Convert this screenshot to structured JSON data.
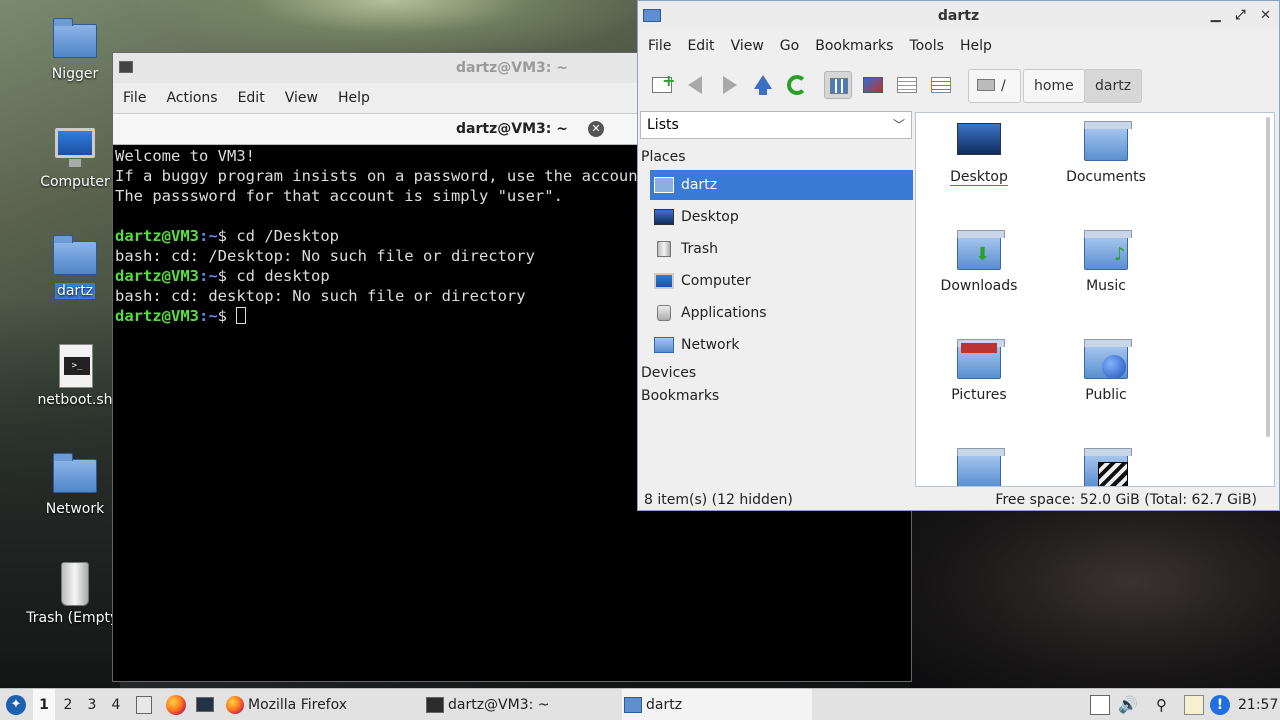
{
  "desktop": {
    "icons": [
      {
        "label": "Nigger",
        "icon": "folder-icon"
      },
      {
        "label": "Computer",
        "icon": "computer-icon"
      },
      {
        "label": "dartz",
        "icon": "home-folder-icon"
      },
      {
        "label": "netboot.sh",
        "icon": "script-file-icon"
      },
      {
        "label": "Network",
        "icon": "network-folder-icon"
      },
      {
        "label": "Trash (Empty)",
        "icon": "trash-icon"
      }
    ]
  },
  "terminal": {
    "window_title": "dartz@VM3: ~",
    "menu": [
      "File",
      "Actions",
      "Edit",
      "View",
      "Help"
    ],
    "tab_title": "dartz@VM3: ~",
    "lines": [
      {
        "type": "text",
        "text": "Welcome to VM3!"
      },
      {
        "type": "text",
        "text": "If a buggy program insists on a password, use the account"
      },
      {
        "type": "text",
        "text": "The passsword for that account is simply \"user\"."
      },
      {
        "type": "text",
        "text": ""
      },
      {
        "type": "prompt",
        "user": "dartz@VM3",
        "path": ":~",
        "cmd": "$ cd /Desktop"
      },
      {
        "type": "text",
        "text": "bash: cd: /Desktop: No such file or directory"
      },
      {
        "type": "prompt",
        "user": "dartz@VM3",
        "path": ":~",
        "cmd": "$ cd desktop"
      },
      {
        "type": "text",
        "text": "bash: cd: desktop: No such file or directory"
      },
      {
        "type": "prompt",
        "user": "dartz@VM3",
        "path": ":~",
        "cmd": "$ "
      }
    ]
  },
  "file_manager": {
    "window_title": "dartz",
    "menu": [
      "File",
      "Edit",
      "View",
      "Go",
      "Bookmarks",
      "Tools",
      "Help"
    ],
    "breadcrumbs": [
      "/",
      "home",
      "dartz"
    ],
    "side_pane_mode": "Lists",
    "sections": {
      "places": "Places",
      "devices": "Devices",
      "bookmarks": "Bookmarks"
    },
    "places": [
      {
        "label": "dartz",
        "icon": "home-folder-icon"
      },
      {
        "label": "Desktop",
        "icon": "desktop-icon"
      },
      {
        "label": "Trash",
        "icon": "trash-icon"
      },
      {
        "label": "Computer",
        "icon": "computer-icon"
      },
      {
        "label": "Applications",
        "icon": "applications-icon"
      },
      {
        "label": "Network",
        "icon": "network-icon"
      }
    ],
    "items": [
      {
        "label": "Desktop",
        "icon": "desktop-folder-icon"
      },
      {
        "label": "Documents",
        "icon": "documents-folder-icon"
      },
      {
        "label": "Downloads",
        "icon": "downloads-folder-icon"
      },
      {
        "label": "Music",
        "icon": "music-folder-icon"
      },
      {
        "label": "Pictures",
        "icon": "pictures-folder-icon"
      },
      {
        "label": "Public",
        "icon": "public-folder-icon"
      },
      {
        "label": "",
        "icon": "folder-icon"
      },
      {
        "label": "",
        "icon": "videos-folder-icon"
      }
    ],
    "status_left": "8 item(s) (12 hidden)",
    "status_right": "Free space: 52.0 GiB (Total: 62.7 GiB)"
  },
  "taskbar": {
    "workspaces": [
      "1",
      "2",
      "3",
      "4"
    ],
    "current_workspace": "1",
    "tasks": [
      {
        "label": "Mozilla Firefox",
        "icon": "firefox-icon"
      },
      {
        "label": "dartz@VM3: ~",
        "icon": "terminal-icon"
      },
      {
        "label": "dartz",
        "icon": "folder-icon"
      }
    ],
    "clock": "21:57"
  },
  "colors": {
    "selection": "#3a7bd5",
    "prompt_user": "#55e03a",
    "prompt_path": "#5b8bef"
  }
}
